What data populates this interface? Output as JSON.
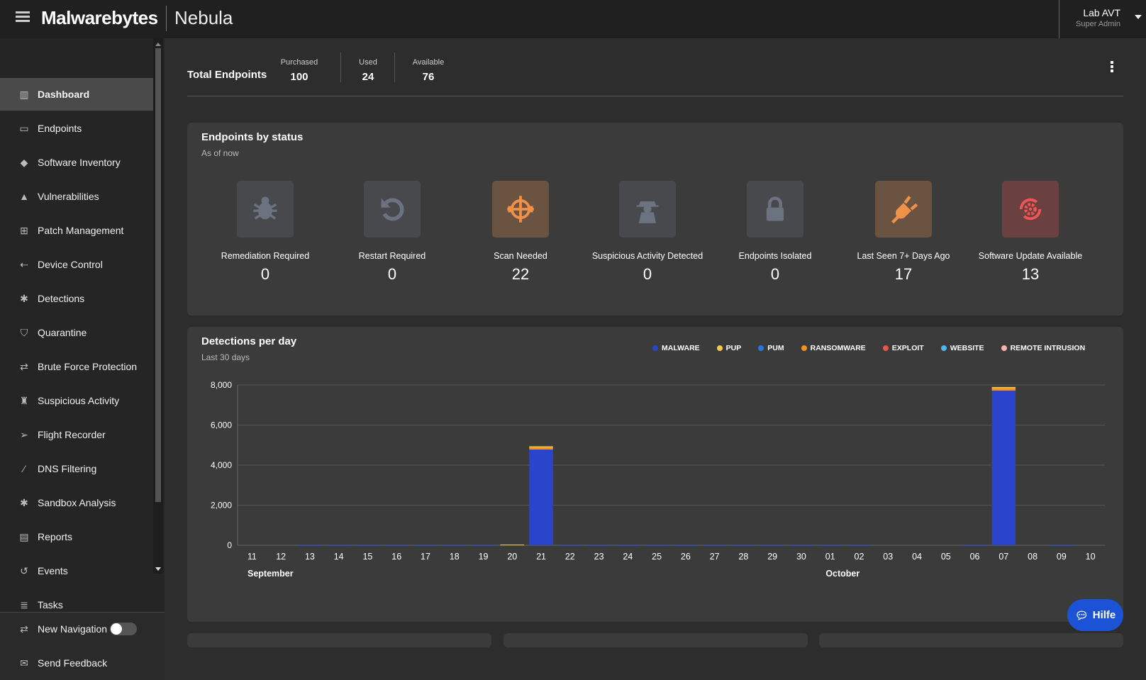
{
  "header": {
    "logo": "Malwarebytes",
    "product": "Nebula",
    "user_name": "Lab AVT",
    "user_role": "Super Admin"
  },
  "sidebar": {
    "items": [
      {
        "label": "Dashboard",
        "icon": "chart-icon",
        "g": "▥"
      },
      {
        "label": "Endpoints",
        "icon": "monitor-icon",
        "g": "▭"
      },
      {
        "label": "Software Inventory",
        "icon": "tag-icon",
        "g": "◆"
      },
      {
        "label": "Vulnerabilities",
        "icon": "warning-icon",
        "g": "▲"
      },
      {
        "label": "Patch Management",
        "icon": "plus-square-icon",
        "g": "⊞"
      },
      {
        "label": "Device Control",
        "icon": "usb-icon",
        "g": "⇠"
      },
      {
        "label": "Detections",
        "icon": "bug-icon",
        "g": "✱"
      },
      {
        "label": "Quarantine",
        "icon": "shield-icon",
        "g": "⛉"
      },
      {
        "label": "Brute Force Protection",
        "icon": "arrows-icon",
        "g": "⇄"
      },
      {
        "label": "Suspicious Activity",
        "icon": "spy-icon",
        "g": "♜"
      },
      {
        "label": "Flight Recorder",
        "icon": "paper-plane-icon",
        "g": "➢"
      },
      {
        "label": "DNS Filtering",
        "icon": "wand-icon",
        "g": "⁄"
      },
      {
        "label": "Sandbox Analysis",
        "icon": "bug-icon",
        "g": "✱"
      },
      {
        "label": "Reports",
        "icon": "document-icon",
        "g": "▤"
      },
      {
        "label": "Events",
        "icon": "history-icon",
        "g": "↺"
      },
      {
        "label": "Tasks",
        "icon": "tasks-icon",
        "g": "≣"
      }
    ],
    "new_navigation": "New Navigation",
    "new_navigation_on": false,
    "send_feedback": "Send Feedback"
  },
  "total_endpoints": {
    "title": "Total Endpoints",
    "purchased_label": "Purchased",
    "purchased": "100",
    "used_label": "Used",
    "used": "24",
    "available_label": "Available",
    "available": "76"
  },
  "status_card": {
    "title": "Endpoints by status",
    "subtitle": "As of now",
    "items": [
      {
        "label": "Remediation Required",
        "value": "0",
        "icon": "bug-icon",
        "bg": "#48494d",
        "fg": "#6b7280"
      },
      {
        "label": "Restart Required",
        "value": "0",
        "icon": "restart-icon",
        "bg": "#48494d",
        "fg": "#6b7280"
      },
      {
        "label": "Scan Needed",
        "value": "22",
        "icon": "crosshair-icon",
        "bg": "#6a5340",
        "fg": "#f0914a"
      },
      {
        "label": "Suspicious Activity Detected",
        "value": "0",
        "icon": "spy-icon",
        "bg": "#48494d",
        "fg": "#6b7280"
      },
      {
        "label": "Endpoints Isolated",
        "value": "0",
        "icon": "lock-icon",
        "bg": "#48494d",
        "fg": "#6b7280"
      },
      {
        "label": "Last Seen 7+ Days Ago",
        "value": "17",
        "icon": "unplug-icon",
        "bg": "#6a5340",
        "fg": "#f0914a"
      },
      {
        "label": "Software Update Available",
        "value": "13",
        "icon": "gear-refresh-icon",
        "bg": "#6a4040",
        "fg": "#f35555"
      }
    ]
  },
  "chart_data": {
    "type": "bar",
    "stacked": true,
    "title": "Detections per day",
    "subtitle": "Last 30 days",
    "ylim": [
      0,
      8000
    ],
    "yticks": [
      "0",
      "2,000",
      "4,000",
      "6,000",
      "8,000"
    ],
    "categories": [
      "11",
      "12",
      "13",
      "14",
      "15",
      "16",
      "17",
      "18",
      "19",
      "20",
      "21",
      "22",
      "23",
      "24",
      "25",
      "26",
      "27",
      "28",
      "29",
      "30",
      "01",
      "02",
      "03",
      "04",
      "05",
      "06",
      "07",
      "08",
      "09",
      "10"
    ],
    "month_labels": [
      {
        "label": "September",
        "index": 0
      },
      {
        "label": "October",
        "index": 20
      }
    ],
    "series": [
      {
        "name": "MALWARE",
        "color": "#2b44cc",
        "values": [
          0,
          0,
          10,
          20,
          20,
          20,
          20,
          10,
          20,
          0,
          4780,
          20,
          20,
          20,
          20,
          20,
          20,
          20,
          20,
          30,
          10,
          20,
          0,
          0,
          0,
          10,
          7720,
          0,
          30,
          0
        ]
      },
      {
        "name": "PUP",
        "color": "#f5cc4a",
        "values": [
          0,
          0,
          0,
          0,
          0,
          0,
          0,
          0,
          0,
          30,
          60,
          0,
          0,
          0,
          0,
          0,
          0,
          0,
          0,
          0,
          0,
          0,
          0,
          0,
          0,
          0,
          60,
          0,
          0,
          0
        ]
      },
      {
        "name": "PUM",
        "color": "#1f7ae0",
        "values": [
          0,
          0,
          0,
          0,
          0,
          0,
          0,
          0,
          0,
          0,
          0,
          0,
          0,
          0,
          0,
          0,
          0,
          0,
          0,
          0,
          0,
          0,
          0,
          0,
          0,
          0,
          0,
          0,
          0,
          0
        ]
      },
      {
        "name": "RANSOMWARE",
        "color": "#f7931e",
        "values": [
          0,
          0,
          0,
          0,
          0,
          0,
          0,
          0,
          0,
          0,
          100,
          0,
          0,
          0,
          0,
          0,
          0,
          0,
          0,
          0,
          0,
          0,
          0,
          0,
          0,
          0,
          120,
          0,
          0,
          0
        ]
      },
      {
        "name": "EXPLOIT",
        "color": "#e85450",
        "values": [
          0,
          0,
          0,
          0,
          0,
          0,
          0,
          0,
          0,
          0,
          0,
          0,
          0,
          0,
          0,
          0,
          0,
          0,
          0,
          0,
          0,
          0,
          0,
          0,
          0,
          0,
          0,
          0,
          0,
          0
        ]
      },
      {
        "name": "WEBSITE",
        "color": "#4fb8ee",
        "values": [
          0,
          0,
          0,
          0,
          0,
          0,
          0,
          0,
          0,
          0,
          0,
          0,
          0,
          0,
          0,
          0,
          0,
          0,
          0,
          0,
          0,
          0,
          0,
          0,
          0,
          0,
          0,
          0,
          0,
          0
        ]
      },
      {
        "name": "REMOTE INTRUSION",
        "color": "#f7b4ae",
        "values": [
          0,
          0,
          0,
          0,
          0,
          0,
          0,
          0,
          0,
          0,
          0,
          0,
          0,
          0,
          0,
          0,
          0,
          0,
          0,
          0,
          0,
          0,
          0,
          0,
          0,
          0,
          0,
          0,
          0,
          0
        ]
      }
    ]
  },
  "help_button": "Hilfe"
}
